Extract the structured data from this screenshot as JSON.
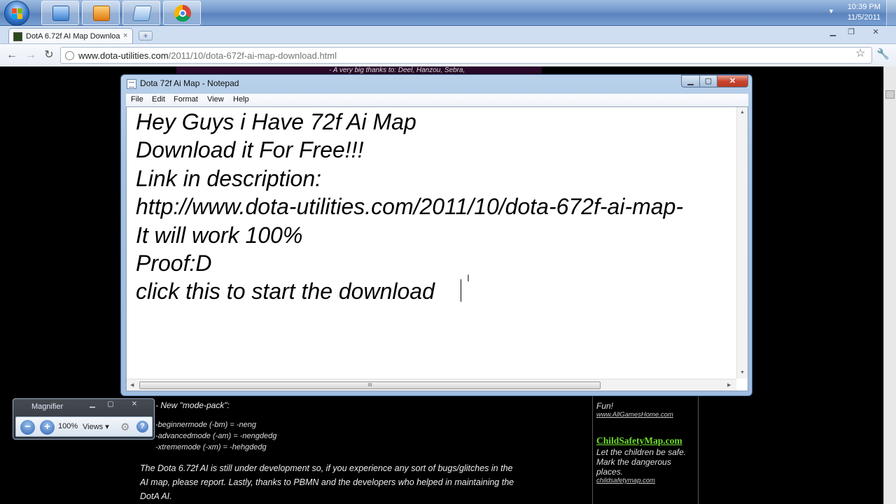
{
  "taskbar": {
    "clock_time": "10:39 PM",
    "clock_date": "11/5/2011",
    "tray_arrow": "▼"
  },
  "browser": {
    "tab_title": "DotA 6.72f AI Map Downloa",
    "tab_close": "×",
    "new_tab": "+",
    "url_domain": "www.dota-utilities.com",
    "url_path": "/2011/10/dota-672f-ai-map-download.html",
    "back": "←",
    "forward": "→",
    "reload": "↻",
    "star": "☆",
    "wrench": "🔧",
    "win_min": "▁",
    "win_max": "❐",
    "win_close": "✕"
  },
  "webpage": {
    "banner_text": "- A very big thanks to: Deel, Hanzou, Sebra,",
    "mode_pack_title": "- New \"mode-pack\":",
    "modes": [
      "-beginnermode (-bm) = -neng",
      "-advancedmode (-am) = -nengdedg",
      "-xtrememode (-xm) = -hehgdedg"
    ],
    "paragraph_lines": [
      "The Dota 6.72f AI is still under development so, if you experience any sort of bugs/glitches in the",
      "AI map, please report. Lastly, thanks to PBMN and the developers who helped in maintaining the",
      "DotA AI."
    ],
    "sidebar_ad_text": "Fun!",
    "sidebar_ad_link": "www.AllGamesHome.com",
    "csm_title": "ChildSafetyMap.com",
    "csm_body": "Let the children be safe. Mark the dangerous places.",
    "csm_link": "childsafetymap.com"
  },
  "magnifier": {
    "title": "Magnifier",
    "zoom": "100%",
    "views": "Views ▾",
    "minus": "−",
    "plus": "+",
    "help": "?"
  },
  "notepad": {
    "title": "Dota 72f Ai Map - Notepad",
    "menu": [
      "File",
      "Edit",
      "Format",
      "View",
      "Help"
    ],
    "lines": [
      "Hey Guys i Have 72f Ai Map",
      "Download it For Free!!!",
      "Link in description:",
      "http://www.dota-utilities.com/2011/10/dota-672f-ai-map-",
      "It will work 100%",
      "Proof:D",
      "click this to start the download"
    ],
    "scroll_grip": "III"
  }
}
